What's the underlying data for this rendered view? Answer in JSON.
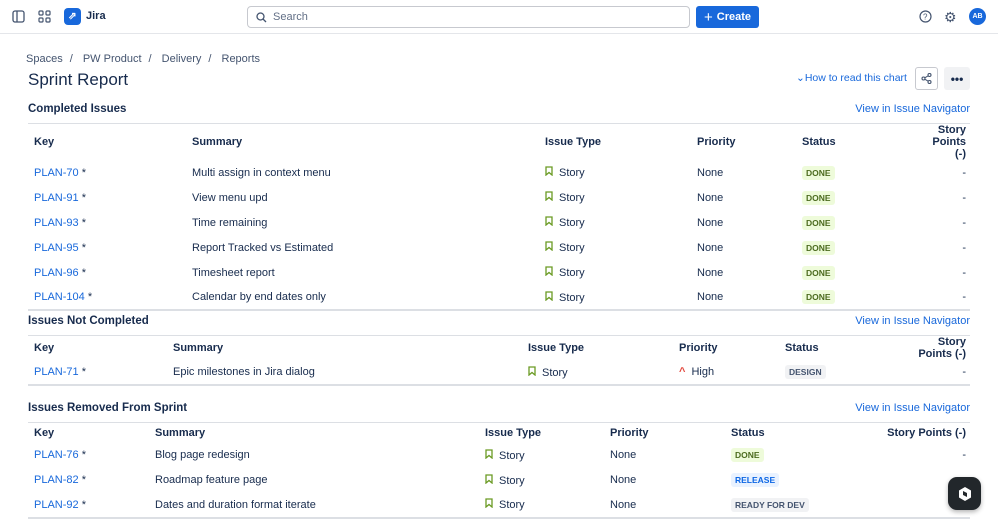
{
  "app": {
    "name": "Jira",
    "avatar": "AB",
    "search_placeholder": "Search",
    "create_label": "Create"
  },
  "breadcrumb": [
    "Spaces",
    "PW Product",
    "Delivery",
    "Reports"
  ],
  "page": {
    "title": "Sprint Report",
    "how_to": "How to read this chart",
    "more": "•••"
  },
  "colors": {
    "accent": "#1868db",
    "done": "#4c6b1f",
    "story": "#6a9a23",
    "high": "#e2483d"
  },
  "sections": [
    {
      "title": "Completed Issues",
      "nav": "View in Issue Navigator",
      "columns": [
        "Key",
        "Summary",
        "Issue Type",
        "Priority",
        "Status",
        "Story Points (-)"
      ],
      "rows": [
        {
          "key": "PLAN-70",
          "summary": "Multi assign in context menu",
          "type": "Story",
          "priority": "None",
          "status": "DONE",
          "points": "-"
        },
        {
          "key": "PLAN-91",
          "summary": "View menu upd",
          "type": "Story",
          "priority": "None",
          "status": "DONE",
          "points": "-"
        },
        {
          "key": "PLAN-93",
          "summary": "Time remaining",
          "type": "Story",
          "priority": "None",
          "status": "DONE",
          "points": "-"
        },
        {
          "key": "PLAN-95",
          "summary": "Report Tracked vs Estimated",
          "type": "Story",
          "priority": "None",
          "status": "DONE",
          "points": "-"
        },
        {
          "key": "PLAN-96",
          "summary": "Timesheet report",
          "type": "Story",
          "priority": "None",
          "status": "DONE",
          "points": "-"
        },
        {
          "key": "PLAN-104",
          "summary": "Calendar by end dates only",
          "type": "Story",
          "priority": "None",
          "status": "DONE",
          "points": "-"
        }
      ]
    },
    {
      "title": "Issues Not Completed",
      "nav": "View in Issue Navigator",
      "columns": [
        "Key",
        "Summary",
        "Issue Type",
        "Priority",
        "Status",
        "Story Points (-)"
      ],
      "rows": [
        {
          "key": "PLAN-71",
          "summary": "Epic milestones in Jira dialog",
          "type": "Story",
          "priority": "High",
          "status": "DESIGN",
          "points": "-"
        }
      ]
    },
    {
      "title": "Issues Removed From Sprint",
      "nav": "View in Issue Navigator",
      "columns": [
        "Key",
        "Summary",
        "Issue Type",
        "Priority",
        "Status",
        "Story Points (-)"
      ],
      "rows": [
        {
          "key": "PLAN-76",
          "summary": "Blog page redesign",
          "type": "Story",
          "priority": "None",
          "status": "DONE",
          "points": "-"
        },
        {
          "key": "PLAN-82",
          "summary": "Roadmap feature page",
          "type": "Story",
          "priority": "None",
          "status": "RELEASE",
          "points": ""
        },
        {
          "key": "PLAN-92",
          "summary": "Dates and duration format iterate",
          "type": "Story",
          "priority": "None",
          "status": "READY FOR DEV",
          "points": ""
        }
      ]
    }
  ]
}
